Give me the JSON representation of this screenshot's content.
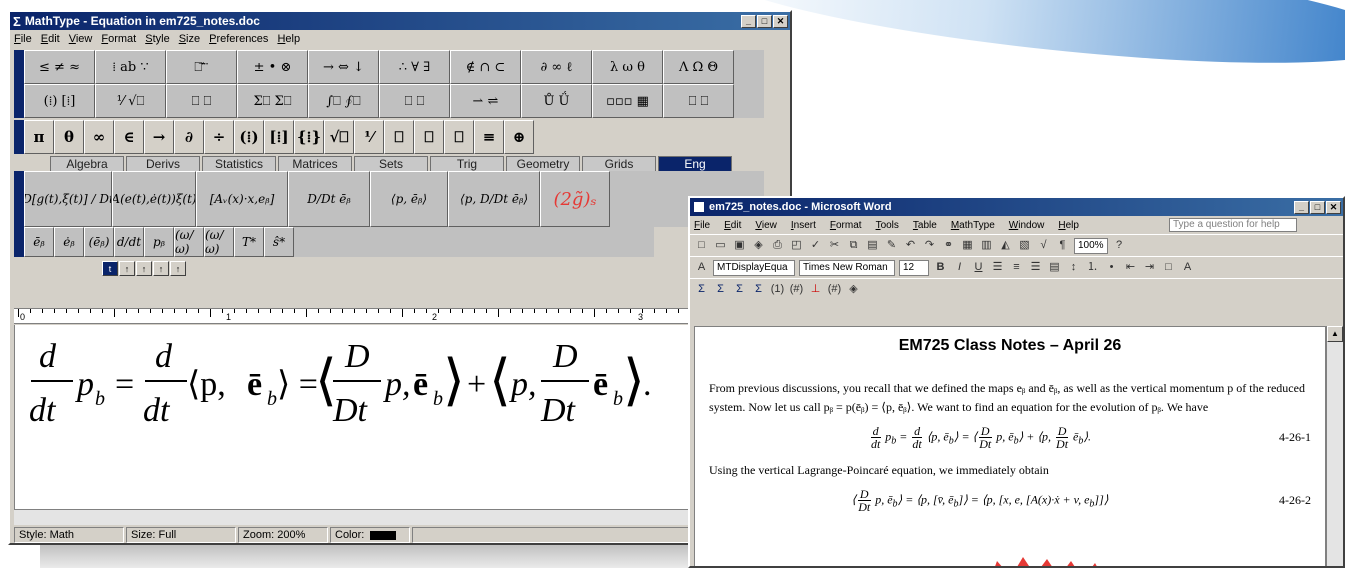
{
  "mathtype": {
    "title": "MathType - Equation in em725_notes.doc",
    "menu": [
      "File",
      "Edit",
      "View",
      "Format",
      "Style",
      "Size",
      "Preferences",
      "Help"
    ],
    "palette_row1": [
      "≤ ≠ ≈",
      "⁞ ab ∵",
      "⎕ ⃗ ⃛",
      "± • ⊗",
      "→ ⇔ ↓",
      "∴ ∀ ∃",
      "∉ ∩ ⊂",
      "∂ ∞ ℓ",
      "λ ω θ",
      "Λ Ω Θ"
    ],
    "palette_row2": [
      "(⁞) [⁞]",
      "⅟ √⎕",
      "⎕ ⎕",
      "Σ⎕ Σ⎕",
      "∫⎕ ∮⎕",
      "⎕ ⎕",
      "⇀ ⇌",
      "Ů Ǘ",
      "▫▫▫ ▦",
      "⎕ ⎕"
    ],
    "symbols": [
      "π",
      "θ",
      "∞",
      "∈",
      "→",
      "∂",
      "÷",
      "(⁞)",
      "[⁞]",
      "{⁞}",
      "√⎕",
      "⅟",
      "⎕",
      "⎕",
      "⎕",
      "≡",
      "⊕"
    ],
    "tabs": [
      "Algebra",
      "Derivs",
      "Statistics",
      "Matrices",
      "Sets",
      "Trig",
      "Geometry",
      "Grids",
      "Eng"
    ],
    "active_tab": "Eng",
    "templates": [
      "D[g(t),ξ(t)] / Dt",
      "[A(e(t),ė(t))ξ(t)]",
      "[Aᵥ(x)·x,eᵦ]",
      "D/Dt ēᵦ",
      "⟨p, ēᵦ⟩",
      "⟨p, D/Dt ēᵦ⟩",
      "(2g̃)ₛ"
    ],
    "small_templates": [
      "ēᵦ",
      "ėᵦ",
      "(ēᵦ)",
      "d/dt",
      "pᵦ",
      "(ω/ω)",
      "(ω/ω)",
      "T*",
      "ŝ*"
    ],
    "size_buttons": [
      "t",
      "↑",
      "↑",
      "↑",
      "↑"
    ],
    "ruler_numbers": [
      "0",
      "1",
      "2",
      "3"
    ],
    "equation": {
      "lhs_num": "d",
      "lhs_den": "dt",
      "lhs_var": "p",
      "rhs1_num": "d",
      "rhs1_den": "dt",
      "rhs2_num": "D",
      "rhs2_den": "Dt",
      "rhs3_num": "D",
      "rhs3_den": "Dt"
    },
    "status": {
      "style": "Style: Math",
      "size": "Size: Full",
      "zoom": "Zoom: 200%",
      "color": "Color:"
    }
  },
  "word": {
    "title": "em725_notes.doc - Microsoft Word",
    "help_placeholder": "Type a question for help",
    "menu": [
      "File",
      "Edit",
      "View",
      "Insert",
      "Format",
      "Tools",
      "Table",
      "MathType",
      "Window",
      "Help"
    ],
    "style_combo": "MTDisplayEqua",
    "font_combo": "Times New Roman",
    "size_combo": "12",
    "zoom_combo": "100%",
    "doc_title": "EM725 Class Notes – April 26",
    "para1": "From previous discussions, you recall that we defined the maps eᵦ and ēᵦ, as well as the vertical momentum p of the reduced system. Now let us call pᵦ = p(ēᵦ) = ⟨p, ēᵦ⟩. We want to find an equation for the evolution of pᵦ. We have",
    "eq1_label": "4-26-1",
    "para2": "Using the vertical Lagrange-Poincaré equation, we immediately obtain",
    "eq2_label": "4-26-2"
  },
  "colors": {
    "titlebar": "#0a246a",
    "window": "#d4d0c8",
    "highlight": "#e53935"
  }
}
